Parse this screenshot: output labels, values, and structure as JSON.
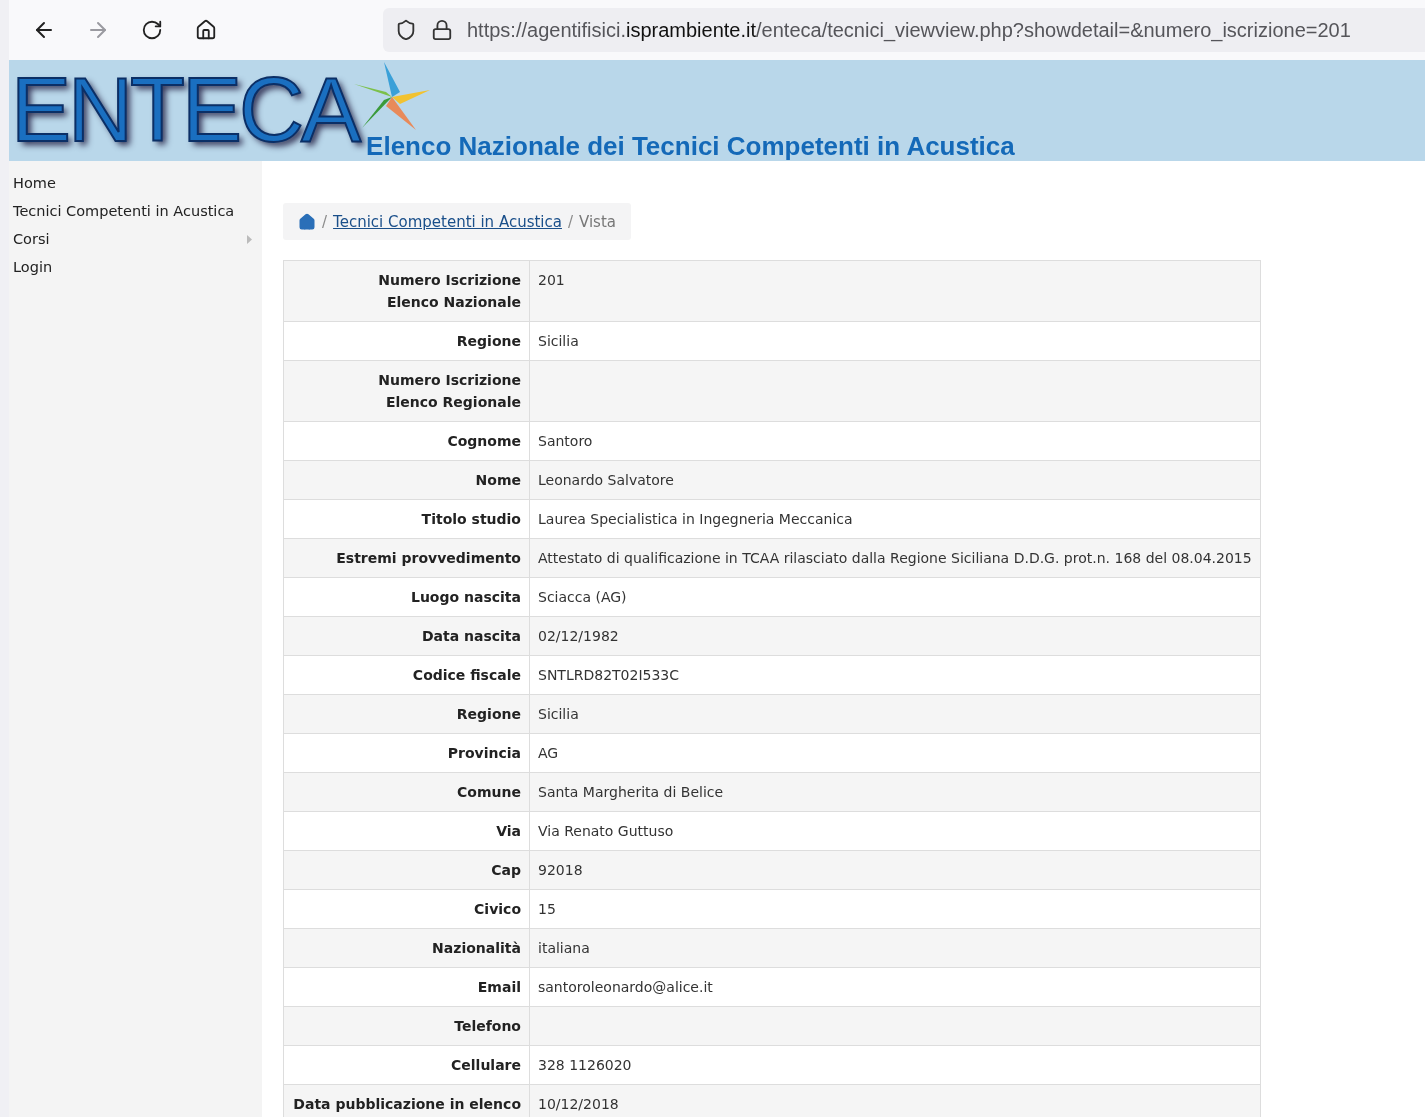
{
  "browser": {
    "url": "https://agentifisici.**isprambiente.it**/enteca/tecnici_viewview.php?showdetail=&numero_iscrizione=201"
  },
  "banner": {
    "logo": "ENTECA",
    "subtitle": "Elenco Nazionale dei Tecnici Competenti in Acustica"
  },
  "sidebar": {
    "items": [
      {
        "label": "Home",
        "submenu": false
      },
      {
        "label": "Tecnici Competenti in Acustica",
        "submenu": false
      },
      {
        "label": "Corsi",
        "submenu": true
      },
      {
        "label": "Login",
        "submenu": false
      }
    ]
  },
  "breadcrumb": {
    "link": "Tecnici Competenti in Acustica",
    "separator": "/",
    "current": "Vista"
  },
  "details": [
    {
      "label": "Numero Iscrizione\nElenco Nazionale",
      "value": "201"
    },
    {
      "label": "Regione",
      "value": "Sicilia"
    },
    {
      "label": "Numero Iscrizione\nElenco Regionale"
    },
    {
      "label": "Cognome",
      "value": "Santoro"
    },
    {
      "label": "Nome",
      "value": "Leonardo Salvatore"
    },
    {
      "label": "Titolo studio",
      "value": "Laurea Specialistica in Ingegneria Meccanica"
    },
    {
      "label": "Estremi provvedimento",
      "value": "Attestato di qualificazione in TCAA rilasciato dalla Regione Siciliana D.D.G. prot.n. 168 del 08.04.2015"
    },
    {
      "label": "Luogo nascita",
      "value": "Sciacca (AG)"
    },
    {
      "label": "Data nascita",
      "value": "02/12/1982"
    },
    {
      "label": "Codice fiscale",
      "value": "SNTLRD82T02I533C"
    },
    {
      "label": "Regione",
      "value": "Sicilia"
    },
    {
      "label": "Provincia",
      "value": "AG"
    },
    {
      "label": "Comune",
      "value": "Santa Margherita di Belice"
    },
    {
      "label": "Via",
      "value": "Via Renato Guttuso"
    },
    {
      "label": "Cap",
      "value": "92018"
    },
    {
      "label": "Civico",
      "value": "15"
    },
    {
      "label": "Nazionalità",
      "value": "italiana"
    },
    {
      "label": "Email",
      "value": "santoroleonardo@alice.it"
    },
    {
      "label": "Telefono"
    },
    {
      "label": "Cellulare",
      "value": "328 1126020"
    },
    {
      "label": "Data pubblicazione in elenco",
      "value": "10/12/2018"
    }
  ]
}
